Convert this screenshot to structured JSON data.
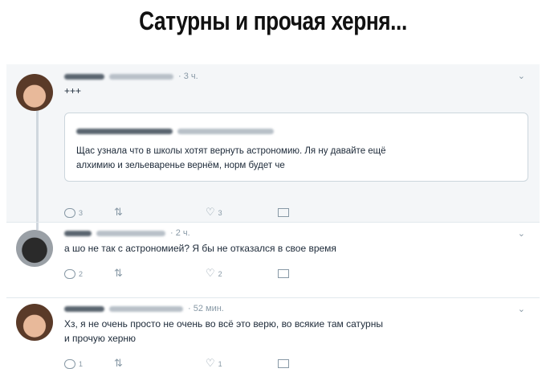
{
  "title": "Сатурны и прочая херня...",
  "tweets": [
    {
      "time": "· 3 ч.",
      "text": "+++",
      "quote": {
        "text_line1": "Щас узнала что в школы хотят вернуть астрономию. Ля ну давайте ещё",
        "text_line2": "алхимию и зельеваренье вернём, норм будет че"
      },
      "replies": "3",
      "likes": "3"
    },
    {
      "time": "· 2 ч.",
      "text": "а шо не так  с астрономией? Я бы не отказался в свое время",
      "replies": "2",
      "likes": "2"
    },
    {
      "time": "· 52 мин.",
      "text_line1": "Хз, я не очень просто не очень во всё это верю, во всякие там сатурны",
      "text_line2": "и прочую херню",
      "replies": "1",
      "likes": "1"
    }
  ],
  "icons": {
    "reply": "reply-icon",
    "retweet": "retweet-icon",
    "like": "heart-icon",
    "message": "message-icon",
    "more": "chevron-down-icon"
  },
  "colors": {
    "meta": "#8899a6",
    "text": "#1c2938",
    "highlight_bg": "#f4f6f8"
  }
}
